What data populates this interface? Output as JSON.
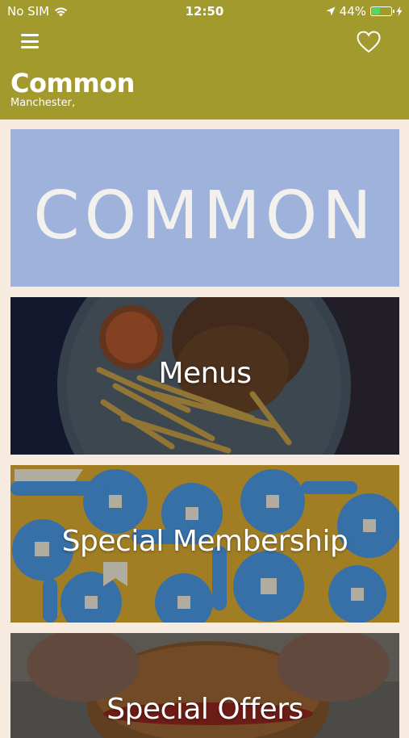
{
  "status_bar": {
    "carrier": "No SIM",
    "time": "12:50",
    "battery_percent": "44%",
    "battery_level": 0.44
  },
  "header": {
    "title": "Common",
    "subtitle": "Manchester,",
    "menu_icon": "hamburger-icon",
    "favorite_icon": "heart-icon",
    "background_color": "#a39a2e"
  },
  "banner": {
    "logo_text": "COMMON",
    "background_color": "#9fb2dc"
  },
  "tiles": [
    {
      "label": "Menus"
    },
    {
      "label": "Special Membership"
    },
    {
      "label": "Special Offers"
    }
  ],
  "colors": {
    "page_background": "#f7ebe0",
    "membership_background": "#b8902a",
    "membership_pattern": "#3f7fbf"
  }
}
